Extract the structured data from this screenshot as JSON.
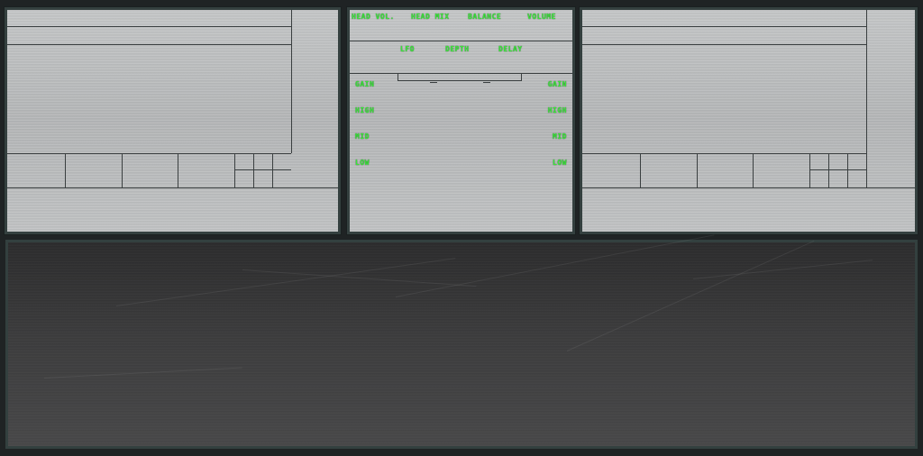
{
  "center_panel": {
    "header_labels": {
      "head_vol": "HEAD VOL.",
      "head_mix": "HEAD MIX",
      "balance": "BALANCE",
      "volume": "VOLUME"
    },
    "fx_labels": {
      "lfo": "LFO",
      "depth": "DEPTH",
      "delay": "DELAY"
    },
    "eq_left": {
      "gain": "GAIN",
      "high": "HIGH",
      "mid": "MID",
      "low": "LOW"
    },
    "eq_right": {
      "gain": "GAIN",
      "high": "HIGH",
      "mid": "MID",
      "low": "LOW"
    }
  },
  "colors": {
    "label_green": "#39e639",
    "frame": "#34403f",
    "brushed_metal": "#bfc1c2",
    "dark_metal": "#3b3b3c"
  }
}
